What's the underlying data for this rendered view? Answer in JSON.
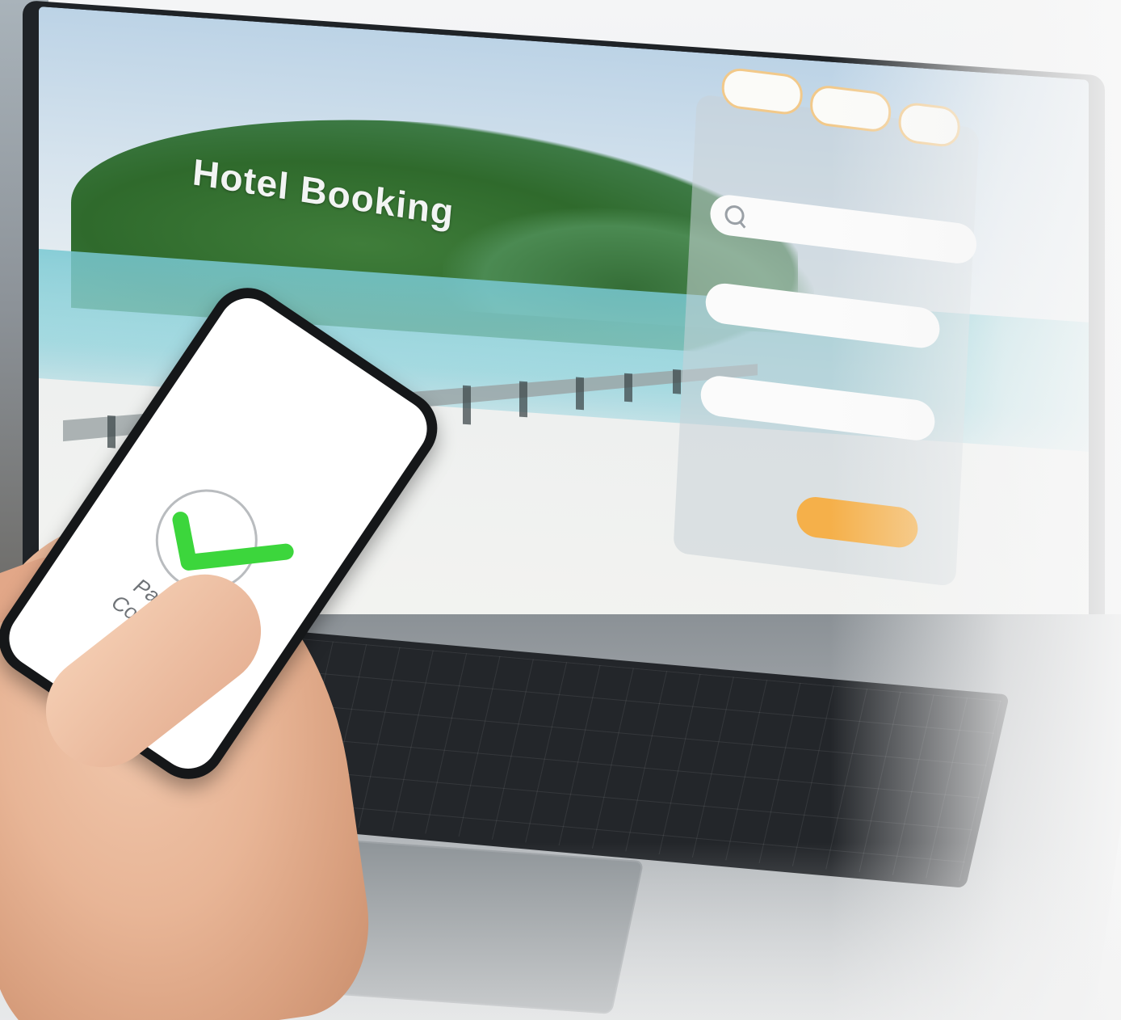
{
  "laptop_screen": {
    "headline": "Hotel Booking",
    "tabs": [
      "",
      "",
      ""
    ],
    "search_placeholder": "",
    "field_2": "",
    "field_3": "",
    "search_button": ""
  },
  "phone": {
    "status_line1": "Payment",
    "status_line2": "Completed",
    "check_color": "#3cd63c"
  },
  "colors": {
    "accent_orange": "#f5b04a",
    "sea": "#a9d2de",
    "foliage": "#2f6a2c"
  }
}
